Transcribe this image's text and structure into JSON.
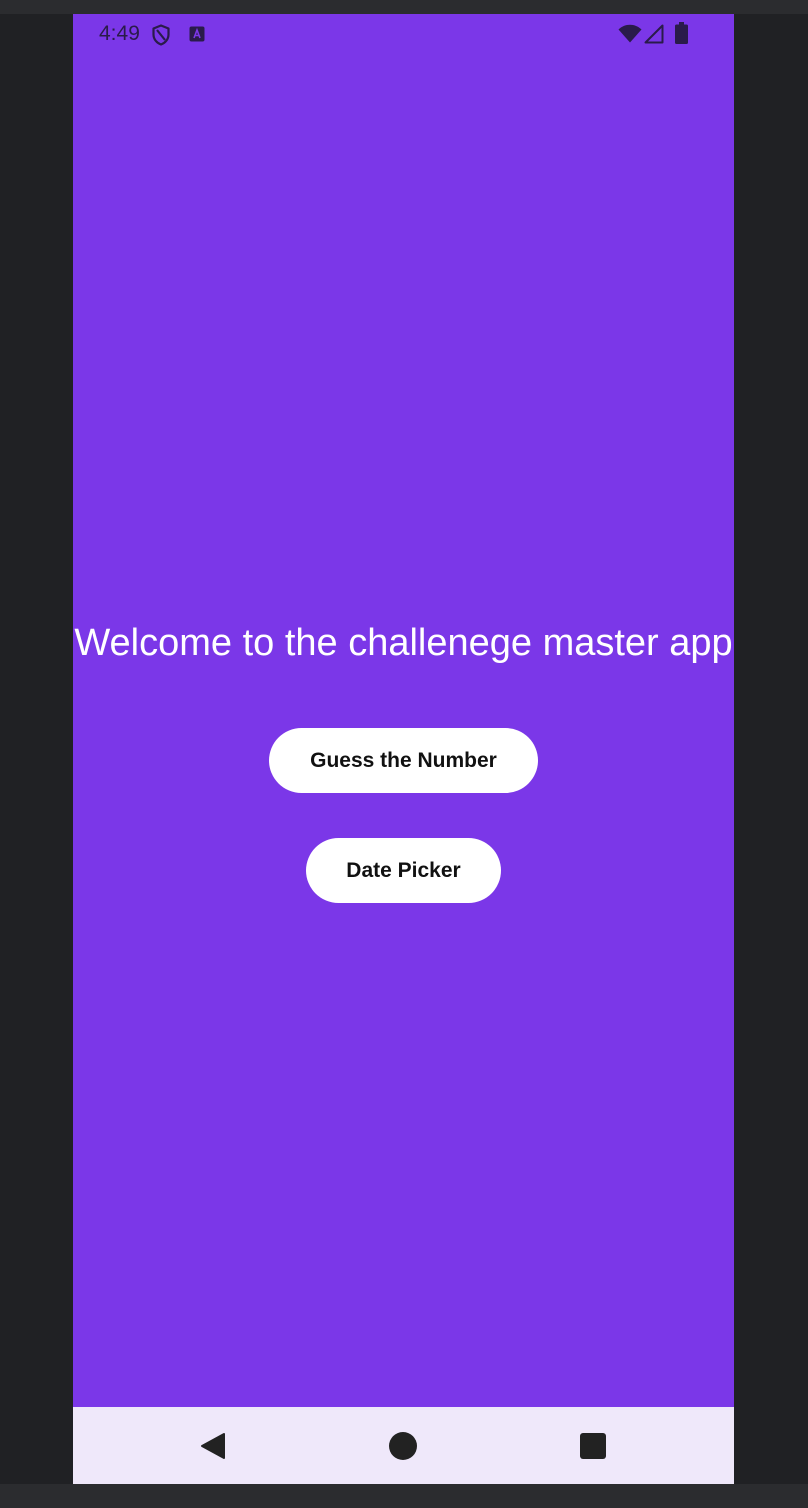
{
  "status_bar": {
    "time": "4:49",
    "icons_left": [
      "shield-icon",
      "app-notification-icon"
    ],
    "icons_right": [
      "wifi-icon",
      "cellular-signal-icon",
      "battery-icon"
    ]
  },
  "main": {
    "title": "Welcome to the challenege master app",
    "buttons": {
      "guess_label": "Guess the Number",
      "date_label": "Date Picker"
    }
  },
  "nav_bar": {
    "items": [
      "back-icon",
      "home-icon",
      "recents-icon"
    ]
  },
  "colors": {
    "background": "#7b37e8",
    "button": "#ffffff",
    "nav_bar": "#efe8fa",
    "status_icons": "#2a1b4a"
  }
}
